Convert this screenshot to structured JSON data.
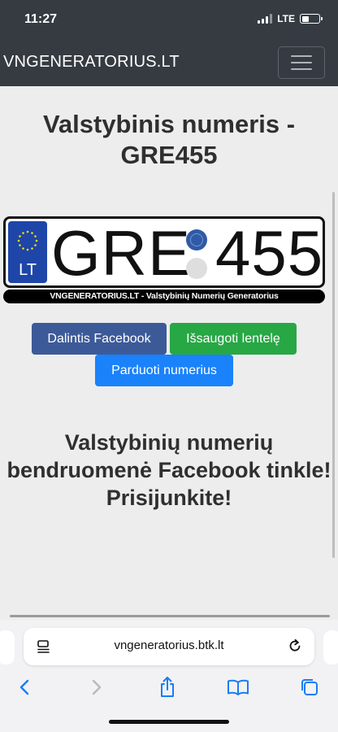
{
  "status_bar": {
    "time": "11:27",
    "network": "LTE"
  },
  "navbar": {
    "brand": "VNGENERATORIUS.LT"
  },
  "main": {
    "title": "Valstybinis numeris - GRE455",
    "plate": {
      "country_code": "LT",
      "letters": "GRE",
      "digits": "455",
      "caption": "VNGENERATORIUS.LT - Valstybinių Numerių Generatorius"
    },
    "buttons": {
      "share_facebook": "Dalintis Facebook",
      "save_plate": "Išsaugoti lentelę",
      "sell_plates": "Parduoti numerius"
    },
    "community_text": "Valstybinių numerių bendruomenė Facebook tinkle! Prisijunkite!"
  },
  "browser": {
    "url": "vngeneratorius.btk.lt"
  },
  "colors": {
    "navbar_bg": "#353b41",
    "facebook_blue": "#3d5a98",
    "success_green": "#28a745",
    "primary_blue": "#1a82fb",
    "eu_blue": "#1e46a8"
  }
}
